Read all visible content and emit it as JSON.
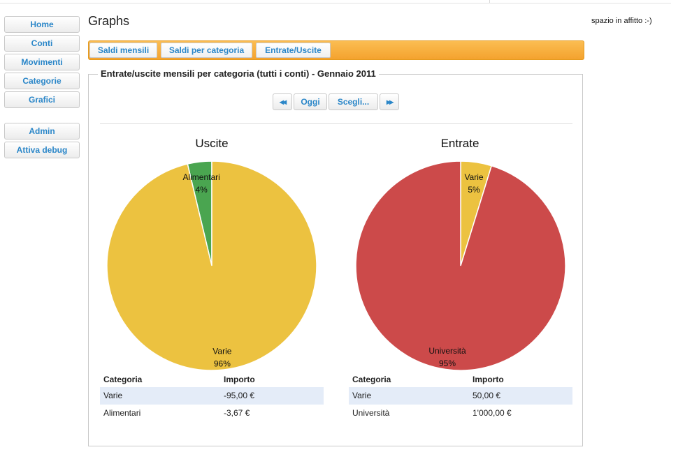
{
  "nav": {
    "items": [
      "Home",
      "Conti",
      "Movimenti",
      "Categorie",
      "Grafici"
    ],
    "admin_items": [
      "Admin",
      "Attiva debug"
    ]
  },
  "page_title": "Graphs",
  "ad_text": "spazio in affitto :-)",
  "tabs": [
    "Saldi mensili",
    "Saldi per categoria",
    "Entrate/Uscite"
  ],
  "panel": {
    "title": "Entrate/uscite mensili per categoria (tutti i conti) - Gennaio 2011",
    "prev_label": "◂◂",
    "today_label": "Oggi",
    "choose_label": "Scegli...",
    "next_label": "▸▸"
  },
  "colors": {
    "varie": "#ecc240",
    "alimentari": "#4aa550",
    "universita": "#cc4a4a",
    "tab_bar": "#f7ad3c",
    "link": "#2a86c8"
  },
  "chart_data": [
    {
      "type": "pie",
      "title": "Uscite",
      "slices": [
        {
          "label": "Alimentari",
          "value": 3.67,
          "percent_label": "4%",
          "color": "#4aa550"
        },
        {
          "label": "Varie",
          "value": 95.0,
          "percent_label": "96%",
          "color": "#ecc240"
        }
      ]
    },
    {
      "type": "pie",
      "title": "Entrate",
      "slices": [
        {
          "label": "Varie",
          "value": 50.0,
          "percent_label": "5%",
          "color": "#ecc240"
        },
        {
          "label": "Università",
          "value": 1000.0,
          "percent_label": "95%",
          "color": "#cc4a4a"
        }
      ]
    }
  ],
  "tables": [
    {
      "headers": [
        "Categoria",
        "Importo"
      ],
      "rows": [
        [
          "Varie",
          "-95,00 €"
        ],
        [
          "Alimentari",
          "-3,67 €"
        ]
      ]
    },
    {
      "headers": [
        "Categoria",
        "Importo"
      ],
      "rows": [
        [
          "Varie",
          "50,00 €"
        ],
        [
          "Università",
          "1'000,00 €"
        ]
      ]
    }
  ]
}
